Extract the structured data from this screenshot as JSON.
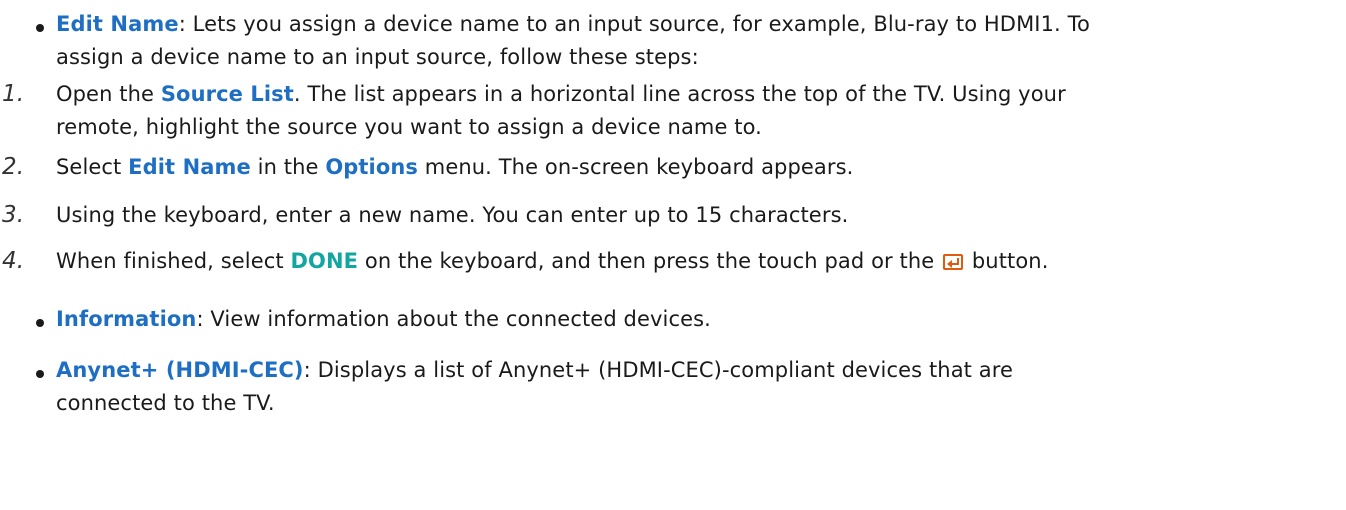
{
  "items": [
    {
      "marker": "•",
      "term": "Edit Name",
      "rest": ": Lets you assign a device name to an input source, for example, Blu-ray to HDMI1. To",
      "rest2": "assign a device name to an input source, follow these steps:"
    },
    {
      "marker": "1.",
      "pre": "Open the ",
      "term": "Source List",
      "rest": ". The list appears in a horizontal line across the top of the TV. Using your",
      "rest2": "remote, highlight the source you want to assign a device name to."
    },
    {
      "marker": "2.",
      "pre": "Select ",
      "term": "Edit Name",
      "mid": " in the ",
      "term2": "Options",
      "rest": " menu. The on-screen keyboard appears."
    },
    {
      "marker": "3.",
      "rest": "Using the keyboard, enter a new name. You can enter up to 15 characters."
    },
    {
      "marker": "4.",
      "pre": "When finished, select ",
      "term": "DONE",
      "rest": " on the keyboard, and then press the touch pad or the ",
      "icon": "enter-icon",
      "rest2": " button."
    },
    {
      "marker": "•",
      "term": "Information",
      "rest": ": View information about the connected devices."
    },
    {
      "marker": "•",
      "term": "Anynet+ (HDMI-CEC)",
      "rest": ": Displays a list of Anynet+ (HDMI-CEC)-compliant devices that are",
      "rest2": "connected to the TV."
    }
  ],
  "colors": {
    "keyword": "#1e6fc4",
    "keyword_done": "#13a6a0",
    "icon": "#e05a10",
    "text": "#1a1a1a"
  }
}
